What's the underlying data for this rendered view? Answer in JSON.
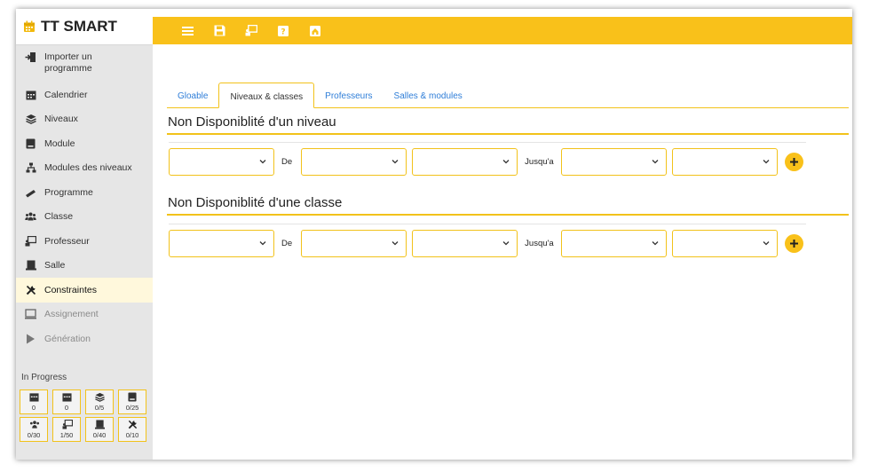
{
  "app": {
    "name": "TT SMART",
    "icon": "calendar-icon"
  },
  "sidebar": {
    "items": [
      {
        "label": "Importer un programme",
        "icon": "import-icon",
        "state": "normal"
      },
      {
        "label": "Calendrier",
        "icon": "calendar-icon",
        "state": "normal"
      },
      {
        "label": "Niveaux",
        "icon": "layers-icon",
        "state": "normal"
      },
      {
        "label": "Module",
        "icon": "book-icon",
        "state": "normal"
      },
      {
        "label": "Modules des niveaux",
        "icon": "sitemap-icon",
        "state": "normal"
      },
      {
        "label": "Programme",
        "icon": "ruler-pencil-icon",
        "state": "normal"
      },
      {
        "label": "Classe",
        "icon": "users-icon",
        "state": "normal"
      },
      {
        "label": "Professeur",
        "icon": "teacher-board-icon",
        "state": "normal"
      },
      {
        "label": "Salle",
        "icon": "desk-icon",
        "state": "normal"
      },
      {
        "label": "Constraintes",
        "icon": "tools-icon",
        "state": "active"
      },
      {
        "label": "Assignement",
        "icon": "monitor-icon",
        "state": "disabled"
      },
      {
        "label": "Génération",
        "icon": "play-icon",
        "state": "disabled"
      }
    ],
    "progress_title": "In Progress",
    "progress": [
      {
        "icon": "calendar-icon",
        "value": "0"
      },
      {
        "icon": "calendar-icon",
        "value": "0"
      },
      {
        "icon": "layers-icon",
        "value": "0/5"
      },
      {
        "icon": "book-icon",
        "value": "0/25"
      },
      {
        "icon": "users-icon",
        "value": "0/30"
      },
      {
        "icon": "teacher-board-icon",
        "value": "1/50"
      },
      {
        "icon": "desk-icon",
        "value": "0/40"
      },
      {
        "icon": "tools-icon",
        "value": "0/10"
      }
    ]
  },
  "toolbar": {
    "icons": [
      "menu-icon",
      "save-icon",
      "teacher-board-icon",
      "help-icon",
      "home-icon"
    ],
    "accent": "#f9c11a"
  },
  "tabs": [
    {
      "label": "Gloable",
      "active": false
    },
    {
      "label": "Niveaux & classes",
      "active": true
    },
    {
      "label": "Professeurs",
      "active": false
    },
    {
      "label": "Salles & modules",
      "active": false
    }
  ],
  "sections": [
    {
      "title": "Non Disponiblité d'un niveau",
      "from_label": "De",
      "to_label": "Jusqu'a"
    },
    {
      "title": "Non Disponiblité d'une classe",
      "from_label": "De",
      "to_label": "Jusqu'a"
    }
  ],
  "colors": {
    "accent": "#f9c11a",
    "tab_link": "#2f7ed8",
    "active_item_bg": "#fff8dc"
  }
}
